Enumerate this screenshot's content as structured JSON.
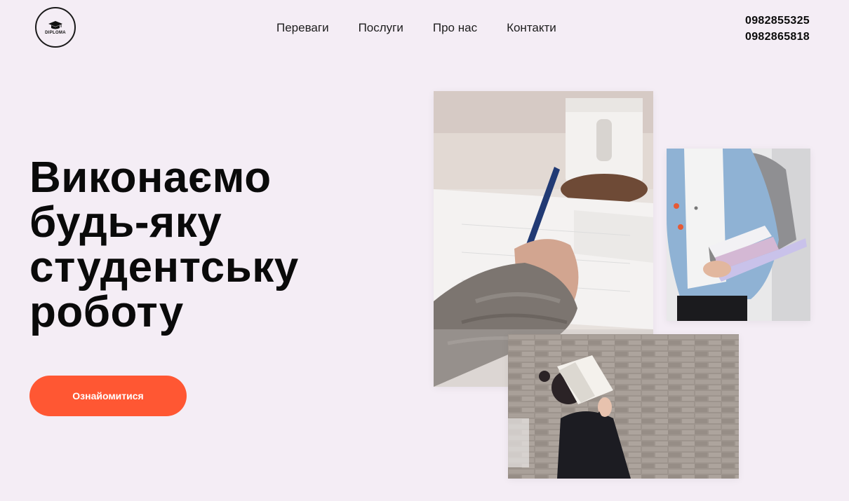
{
  "header": {
    "logo_text": "DIPLOMA",
    "nav": [
      {
        "label": "Переваги"
      },
      {
        "label": "Послуги"
      },
      {
        "label": "Про нас"
      },
      {
        "label": "Контакти"
      }
    ],
    "phones": [
      "0982855325",
      "0982865818"
    ]
  },
  "hero": {
    "title_lines": [
      "Виконаємо",
      "будь-яку",
      "студентську",
      "роботу"
    ],
    "cta_label": "Ознайомитися"
  },
  "colors": {
    "background": "#f4edf5",
    "accent": "#ff5733",
    "text": "#0a0a0a"
  },
  "icons": {
    "logo": "graduation-cap-icon"
  }
}
